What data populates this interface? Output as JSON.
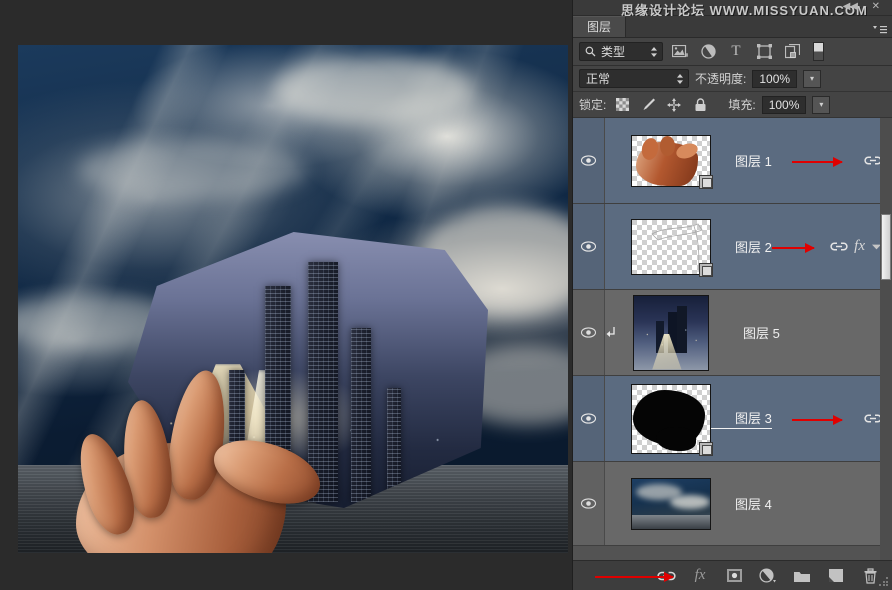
{
  "app": {
    "watermark": "思缘设计论坛 WWW.MISSYUAN.COM",
    "collapse_icon": "◀◀",
    "close_icon": "✕",
    "panel_menu_icon": "menu-icon"
  },
  "panel": {
    "tab_label": "图层",
    "filter": {
      "search_icon": "search-icon",
      "kind_label": "类型",
      "stepper_icon": "updown-stepper-icon",
      "icons": [
        {
          "name": "filter-pixel-icon",
          "title": "像素图层"
        },
        {
          "name": "filter-adjustment-icon",
          "title": "调整图层"
        },
        {
          "name": "filter-type-icon",
          "title": "文字图层",
          "glyph": "T"
        },
        {
          "name": "filter-shape-icon",
          "title": "形状图层"
        },
        {
          "name": "filter-smartobject-icon",
          "title": "智能对象"
        }
      ],
      "toggle_name": "filter-enable-toggle"
    },
    "blend": {
      "mode_value": "正常",
      "opacity_label": "不透明度:",
      "opacity_value": "100%",
      "opacity_arrow": "▾"
    },
    "lock": {
      "label": "锁定:",
      "items": [
        {
          "name": "lock-transparent-pixels-icon"
        },
        {
          "name": "lock-image-pixels-icon"
        },
        {
          "name": "lock-position-icon"
        },
        {
          "name": "lock-all-icon"
        }
      ],
      "fill_label": "填充:",
      "fill_value": "100%",
      "fill_arrow": "▾"
    },
    "layers": [
      {
        "name": "图层 1",
        "selected": true,
        "visible": true,
        "clipped": false,
        "thumb": "hand",
        "smart_object_badge": true,
        "link_icon": true,
        "fx_icon": false,
        "expand_icon": false,
        "red_arrow": true
      },
      {
        "name": "图层 2",
        "selected": true,
        "visible": true,
        "clipped": false,
        "thumb": "transparent-sketch",
        "smart_object_badge": true,
        "link_icon": true,
        "fx_icon": true,
        "expand_icon": true,
        "red_arrow": true
      },
      {
        "name": "图层 5",
        "selected": false,
        "visible": true,
        "clipped": true,
        "thumb": "city-night",
        "smart_object_badge": false,
        "link_icon": false,
        "fx_icon": false,
        "expand_icon": false,
        "red_arrow": false
      },
      {
        "name": "图层 3",
        "selected": true,
        "visible": true,
        "clipped": false,
        "thumb": "black-blob",
        "smart_object_badge": true,
        "link_icon": true,
        "fx_icon": false,
        "expand_icon": false,
        "red_arrow": true,
        "name_underlined": true
      },
      {
        "name": "图层 4",
        "selected": false,
        "visible": true,
        "clipped": false,
        "thumb": "sky-sea",
        "smart_object_badge": false,
        "link_icon": false,
        "fx_icon": false,
        "expand_icon": false,
        "red_arrow": false
      }
    ],
    "footer": {
      "red_arrow": true,
      "buttons": [
        {
          "name": "link-layers-button",
          "label": "链接图层"
        },
        {
          "name": "layer-style-button",
          "label": "fx"
        },
        {
          "name": "add-layer-mask-button",
          "label": "添加图层蒙版"
        },
        {
          "name": "new-adjustment-layer-button",
          "label": "创建新的填充或调整图层"
        },
        {
          "name": "new-group-button",
          "label": "创建新组"
        },
        {
          "name": "new-layer-button",
          "label": "创建新图层"
        },
        {
          "name": "delete-layer-button",
          "label": "删除图层"
        }
      ]
    }
  },
  "canvas": {
    "document_name": "hand-holding-city-composite"
  },
  "colors": {
    "panel_bg": "#3c3c3c",
    "row_bg": "#686868",
    "row_selected_bg": "#5b6b80",
    "annotation_red": "#e00000",
    "text": "#f0f0f0",
    "field_bg": "#2e2e2e"
  }
}
